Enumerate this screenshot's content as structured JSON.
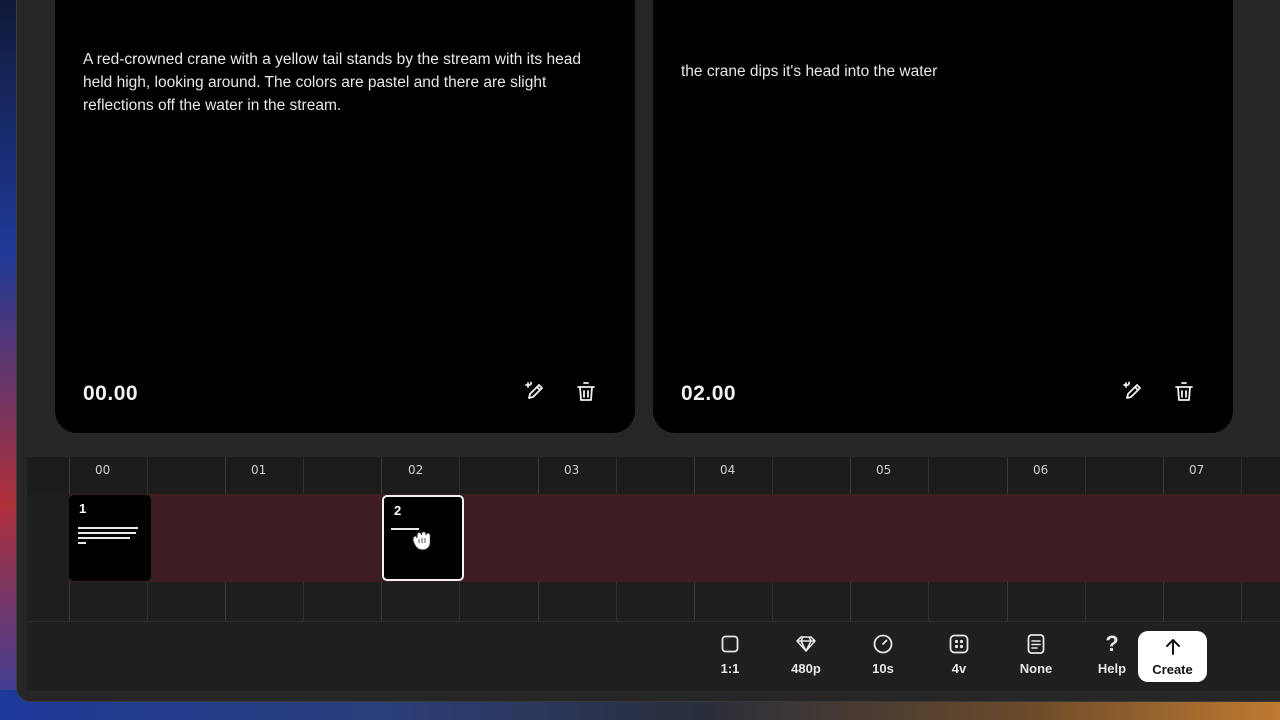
{
  "cards": [
    {
      "prompt": "A red-crowned crane with a yellow tail stands by the stream with its head held high, looking around. The colors are pastel and there are slight reflections off the water in the stream.",
      "time": "00.00",
      "edit_icon": "magic-pencil-icon",
      "delete_icon": "trash-icon"
    },
    {
      "prompt": "the crane dips it's head into the water",
      "time": "02.00",
      "edit_icon": "magic-pencil-icon",
      "delete_icon": "trash-icon"
    }
  ],
  "timeline": {
    "ticks": [
      "00",
      "01",
      "02",
      "03",
      "04",
      "05",
      "06",
      "07"
    ],
    "clips": [
      {
        "number": "1",
        "selected": false
      },
      {
        "number": "2",
        "selected": true
      }
    ],
    "track_color": "#3d1d22"
  },
  "toolbar": {
    "items": [
      {
        "label": "1:1",
        "icon": "square-icon"
      },
      {
        "label": "480p",
        "icon": "diamond-icon"
      },
      {
        "label": "10s",
        "icon": "clock-icon"
      },
      {
        "label": "4v",
        "icon": "grid-icon"
      },
      {
        "label": "None",
        "icon": "preset-icon"
      },
      {
        "label": "Help",
        "icon": "question-icon"
      }
    ],
    "create_label": "Create",
    "create_icon": "arrow-up-icon"
  }
}
